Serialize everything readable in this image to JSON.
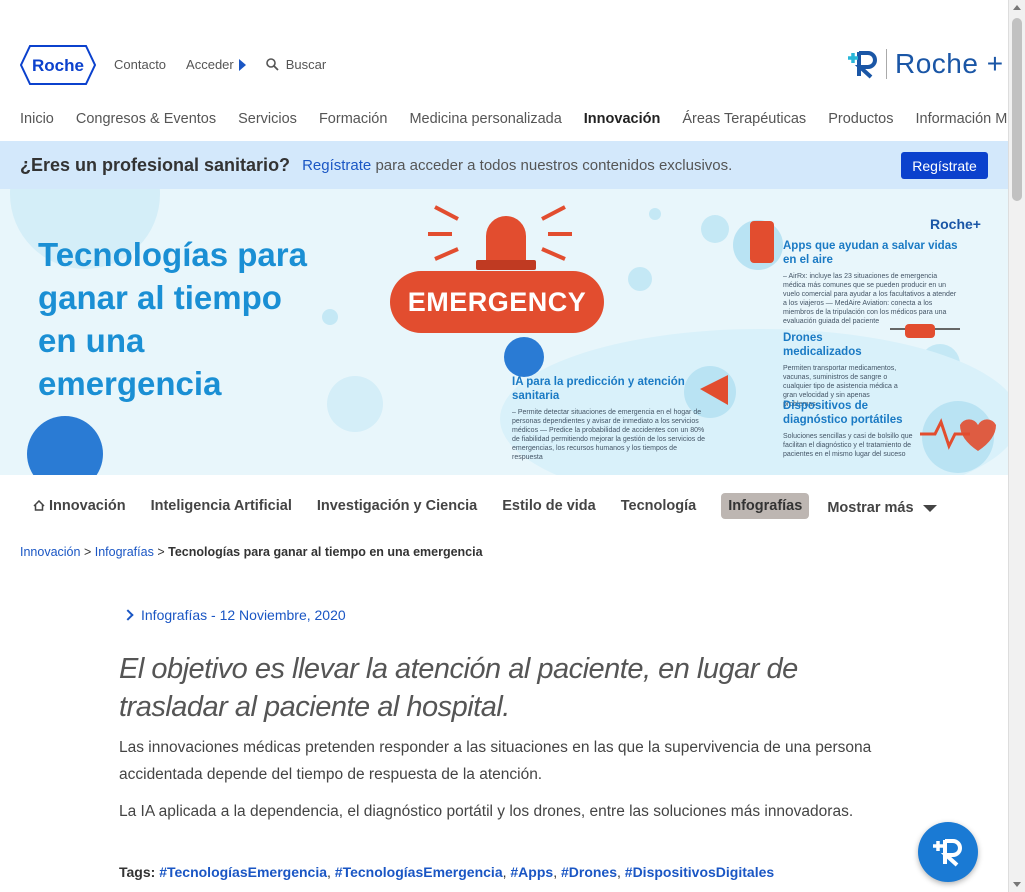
{
  "header": {
    "logo_text": "Roche",
    "contact": "Contacto",
    "login": "Acceder",
    "search_placeholder": "Buscar",
    "brand_plus": "Roche +",
    "nav": [
      "Inicio",
      "Congresos & Eventos",
      "Servicios",
      "Formación",
      "Medicina personalizada",
      "Innovación",
      "Áreas Terapéuticas",
      "Productos",
      "Información Médica"
    ],
    "active_nav": "Innovación"
  },
  "register_bar": {
    "question": "¿Eres un profesional sanitario?",
    "link": "Regístrate",
    "message": "para acceder a todos nuestros contenidos exclusivos.",
    "button": "Regístrate"
  },
  "hero": {
    "title": "Tecnologías para ganar al tiempo en una emergencia",
    "badge": "EMERGENCY",
    "logo": "Roche+",
    "blocks": [
      {
        "heading": "Apps que ayudan a salvar vidas en el aire",
        "text": "– AirRx: incluye las 23 situaciones de emergencia médica más comunes que se pueden producir en un vuelo comercial para ayudar a los facultativos a atender a los viajeros — MedAire Aviation: conecta a los miembros de la tripulación con los médicos para una evaluación guiada del paciente"
      },
      {
        "heading": "Drones medicalizados",
        "text": "Permiten transportar medicamentos, vacunas, suministros de sangre o cualquier tipo de asistencia médica a gran velocidad y sin apenas problemas"
      },
      {
        "heading": "IA para la predicción y atención sanitaria",
        "text": "– Permite detectar situaciones de emergencia en el hogar de personas dependientes y avisar de inmediato a los servicios médicos — Predice la probabilidad de accidentes con un 80% de fiabilidad permitiendo mejorar la gestión de los servicios de emergencias, los recursos humanos y los tiempos de respuesta"
      },
      {
        "heading": "Dispositivos de diagnóstico portátiles",
        "text": "Soluciones sencillas y casi de bolsillo que facilitan el diagnóstico y el tratamiento de pacientes en el mismo lugar del suceso"
      }
    ]
  },
  "subnav": {
    "items": [
      "Innovación",
      "Inteligencia Artificial",
      "Investigación y Ciencia",
      "Estilo de vida",
      "Tecnología",
      "Infografías"
    ],
    "active": "Infografías",
    "more": "Mostrar más"
  },
  "breadcrumb": {
    "level1": "Innovación",
    "level2": "Infografías",
    "current": "Tecnologías para ganar al tiempo en una emergencia"
  },
  "article": {
    "meta": "Infografías - 12 Noviembre, 2020",
    "lead": "El objetivo es llevar la atención al paciente, en lugar de trasladar al paciente al hospital.",
    "p1": "Las innovaciones médicas pretenden responder a las situaciones en las que la supervivencia de una persona accidentada depende del tiempo de respuesta de la atención.",
    "p2": "La IA aplicada a la dependencia, el diagnóstico portátil y los drones, entre las soluciones más innovadoras.",
    "tags_label": "Tags:",
    "tags": [
      "#TecnologíasEmergencia",
      "#TecnologíasEmergencia",
      "#Apps",
      "#Drones",
      "#DispositivosDigitales"
    ]
  },
  "colors": {
    "brand_blue": "#0b41cd",
    "link_blue": "#1a56c4",
    "banner_bg": "#d3e8fb",
    "hero_bg": "#e8f6fb",
    "emergency_red": "#e24d2f"
  }
}
